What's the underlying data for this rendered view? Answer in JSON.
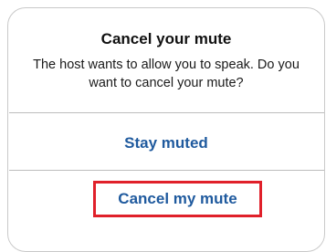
{
  "dialog": {
    "title": "Cancel your mute",
    "message": "The host wants to allow you to speak. Do you want to cancel your mute?",
    "actions": {
      "stay_muted": "Stay muted",
      "cancel_mute": "Cancel my mute"
    },
    "highlight_color": "#e0202a",
    "action_color": "#1f5a9e"
  }
}
